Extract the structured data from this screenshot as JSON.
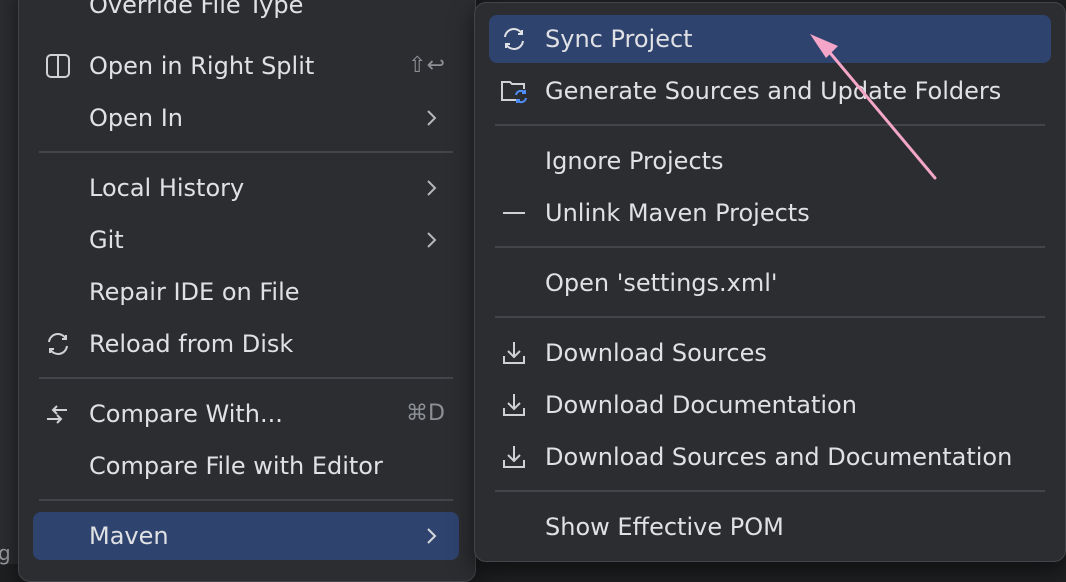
{
  "background": {
    "edge_letter": "g"
  },
  "left_menu": {
    "items": [
      {
        "label": "Override File Type"
      },
      {
        "label": "Open in Right Split",
        "icon": "split-icon",
        "shortcut": "⇧↩"
      },
      {
        "label": "Open In",
        "submenu": true
      },
      {
        "label": "Local History",
        "submenu": true
      },
      {
        "label": "Git",
        "submenu": true
      },
      {
        "label": "Repair IDE on File"
      },
      {
        "label": "Reload from Disk",
        "icon": "reload-icon"
      },
      {
        "label": "Compare With...",
        "icon": "compare-icon",
        "shortcut": "⌘D"
      },
      {
        "label": "Compare File with Editor"
      },
      {
        "label": "Maven",
        "submenu": true,
        "selected": true
      }
    ]
  },
  "right_menu": {
    "items": [
      {
        "label": "Sync Project",
        "icon": "sync-icon",
        "selected": true
      },
      {
        "label": "Generate Sources and Update Folders",
        "icon": "folder-sync-icon"
      },
      {
        "label": "Ignore Projects"
      },
      {
        "label": "Unlink Maven Projects",
        "icon": "minus-icon"
      },
      {
        "label": "Open 'settings.xml'"
      },
      {
        "label": "Download Sources",
        "icon": "download-icon"
      },
      {
        "label": "Download Documentation",
        "icon": "download-icon"
      },
      {
        "label": "Download Sources and Documentation",
        "icon": "download-icon"
      },
      {
        "label": "Show Effective POM"
      }
    ]
  },
  "colors": {
    "menu_bg": "#2b2d30",
    "selection": "#2e436e",
    "text": "#dfe1e5",
    "muted": "#8c8f94",
    "accent_blue": "#4f8ef7",
    "annotation_pink": "#f3a6c8"
  }
}
